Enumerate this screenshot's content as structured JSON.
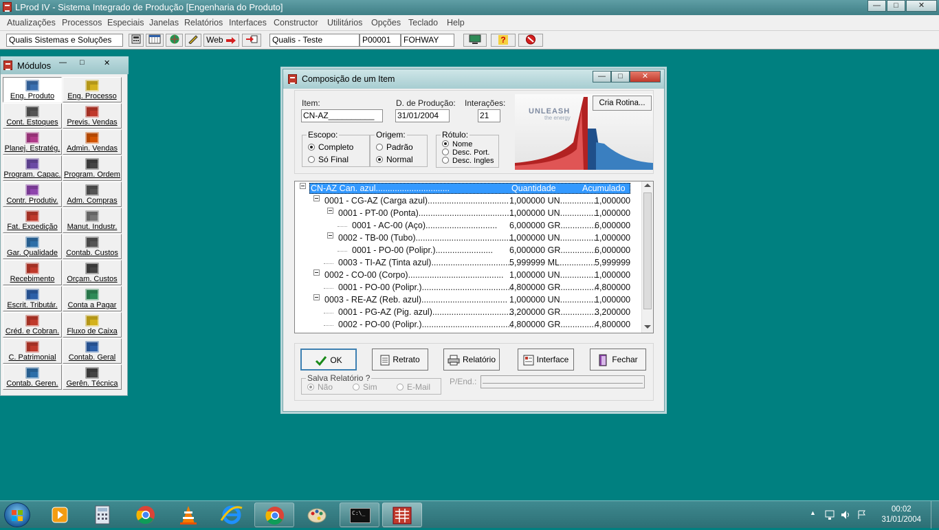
{
  "window": {
    "title": "LProd IV - Sistema Integrado de Produção [Engenharia do Produto]",
    "minimize": "—",
    "maximize": "□",
    "close": "✕"
  },
  "menu": [
    "Atualizações",
    "Processos",
    "Especiais",
    "Janelas",
    "Relatórios",
    "Interfaces",
    "Constructor",
    "Utilitários",
    "Opções",
    "Teclado",
    "Help"
  ],
  "toolbar": {
    "company": "Qualis Sistemas e Soluções",
    "web_label": "Web",
    "environment": "Qualis - Teste",
    "code": "P00001",
    "user": "FOHWAY",
    "help_glyph": "?"
  },
  "modules": {
    "title": "Módulos",
    "items": [
      {
        "label": "Eng. Produto",
        "icon": "handshake-icon",
        "color": "#3a6fb0",
        "active": true
      },
      {
        "label": "Eng. Processo",
        "icon": "lightbulb-icon",
        "color": "#d4b21c"
      },
      {
        "label": "Cont. Estoques",
        "icon": "boxes-icon",
        "color": "#555555"
      },
      {
        "label": "Previs. Vendas",
        "icon": "pie-chart-icon",
        "color": "#c0392b"
      },
      {
        "label": "Planej. Estratég.",
        "icon": "bar-chart-icon",
        "color": "#b03a8a"
      },
      {
        "label": "Admin. Vendas",
        "icon": "cart-icon",
        "color": "#d35400"
      },
      {
        "label": "Program. Capac.",
        "icon": "grid-icon",
        "color": "#6b4aa5"
      },
      {
        "label": "Program. Ordem",
        "icon": "calendar-icon",
        "color": "#444444"
      },
      {
        "label": "Contr. Produtiv.",
        "icon": "line-chart-icon",
        "color": "#8e44ad"
      },
      {
        "label": "Adm. Compras",
        "icon": "document-icon",
        "color": "#555555"
      },
      {
        "label": "Fat. Expedição",
        "icon": "arrow-doc-icon",
        "color": "#c0392b"
      },
      {
        "label": "Manut. Industr.",
        "icon": "tools-icon",
        "color": "#777777"
      },
      {
        "label": "Gar. Qualidade",
        "icon": "chart-axes-icon",
        "color": "#2e6fa8"
      },
      {
        "label": "Contab. Custos",
        "icon": "calculator-icon",
        "color": "#555555"
      },
      {
        "label": "Recebimento",
        "icon": "receive-icon",
        "color": "#c0392b"
      },
      {
        "label": "Orçam. Custos",
        "icon": "books-icon",
        "color": "#444444"
      },
      {
        "label": "Escrit. Tributár.",
        "icon": "bars-icon",
        "color": "#2c5fa8"
      },
      {
        "label": "Conta a Pagar",
        "icon": "money-icon",
        "color": "#2e8b57"
      },
      {
        "label": "Créd. e Cobran.",
        "icon": "printer-icon",
        "color": "#c0392b"
      },
      {
        "label": "Fluxo de Caixa",
        "icon": "cash-flow-icon",
        "color": "#d4b21c"
      },
      {
        "label": "C. Patrimonial",
        "icon": "blocks-icon",
        "color": "#c0392b"
      },
      {
        "label": "Contab. Geral",
        "icon": "ledger-icon",
        "color": "#2c5fa8"
      },
      {
        "label": "Contab. Geren.",
        "icon": "report-icon",
        "color": "#2e6fa8"
      },
      {
        "label": "Gerên. Técnica",
        "icon": "computer-icon",
        "color": "#444444"
      }
    ]
  },
  "dialog": {
    "title": "Composição de um Item",
    "item_label": "Item:",
    "item_value": "CN-AZ__________",
    "date_label": "D. de Produção:",
    "date_value": "31/01/2004",
    "iter_label": "Interações:",
    "iter_value": "21",
    "cria_rotina": "Cria Rotina...",
    "banner_big": "UNLEASH",
    "banner_small": "the energy",
    "escopo": {
      "title": "Escopo:",
      "options": [
        "Completo",
        "Só Final"
      ],
      "selected": 0
    },
    "origem": {
      "title": "Origem:",
      "options": [
        "Padrão",
        "Normal"
      ],
      "selected": 1
    },
    "rotulo": {
      "title": "Rótulo:",
      "options": [
        "Nome",
        "Desc. Port.",
        "Desc. Ingles"
      ],
      "selected": 0
    },
    "tree": {
      "header": {
        "text": "CN-AZ  Can. azul...............................",
        "qty": "Quantidade",
        "acc": "Acumulado"
      },
      "rows": [
        {
          "level": 1,
          "box": true,
          "text": "0001 - CG-AZ (Carga azul)..................................",
          "qty": "1,000000 UN...............",
          "acc": "1,000000"
        },
        {
          "level": 2,
          "box": true,
          "text": "0001 - PT-00 (Ponta).........................................",
          "qty": "1,000000 UN...............",
          "acc": "1,000000"
        },
        {
          "level": 3,
          "box": false,
          "text": "0001 - AC-00 (Aço)..............................",
          "qty": "6,000000 GR...............",
          "acc": "6,000000"
        },
        {
          "level": 2,
          "box": true,
          "text": "0002 - TB-00 (Tubo)..........................................",
          "qty": "1,000000 UN...............",
          "acc": "1,000000"
        },
        {
          "level": 3,
          "box": false,
          "text": "0001 - PO-00 (Polipr.)........................",
          "qty": "6,000000 GR...............",
          "acc": "6,000000"
        },
        {
          "level": 2,
          "box": false,
          "text": "0003 - TI-AZ (Tinta azul)..................................",
          "qty": "5,999999 ML...............",
          "acc": "5,999999"
        },
        {
          "level": 1,
          "box": true,
          "text": "0002 - CO-00 (Corpo)........................................",
          "qty": "1,000000 UN...............",
          "acc": "1,000000"
        },
        {
          "level": 2,
          "box": false,
          "text": "0001 - PO-00 (Polipr.)......................................",
          "qty": "4,800000 GR...............",
          "acc": "4,800000"
        },
        {
          "level": 1,
          "box": true,
          "text": "0003 - RE-AZ (Reb. azul)....................................",
          "qty": "1,000000 UN...............",
          "acc": "1,000000"
        },
        {
          "level": 2,
          "box": false,
          "text": "0001 - PG-AZ (Pig. azul)..................................",
          "qty": "3,200000 GR...............",
          "acc": "3,200000"
        },
        {
          "level": 2,
          "box": false,
          "text": "0002 - PO-00 (Polipr.)......................................",
          "qty": "4,800000 GR...............",
          "acc": "4,800000"
        }
      ]
    },
    "buttons": {
      "ok": "OK",
      "retrato": "Retrato",
      "relatorio": "Relatório",
      "interface": "Interface",
      "fechar": "Fechar"
    },
    "salva": {
      "title": "Salva Relatório ?",
      "options": [
        "Não",
        "Sim",
        "E-Mail"
      ],
      "selected": 0
    },
    "pend_label": "P/End.:"
  },
  "taskbar": {
    "time": "00:02",
    "date": "31/01/2004",
    "tray_arrow": "▲",
    "cmd_text": "C:\\_"
  }
}
